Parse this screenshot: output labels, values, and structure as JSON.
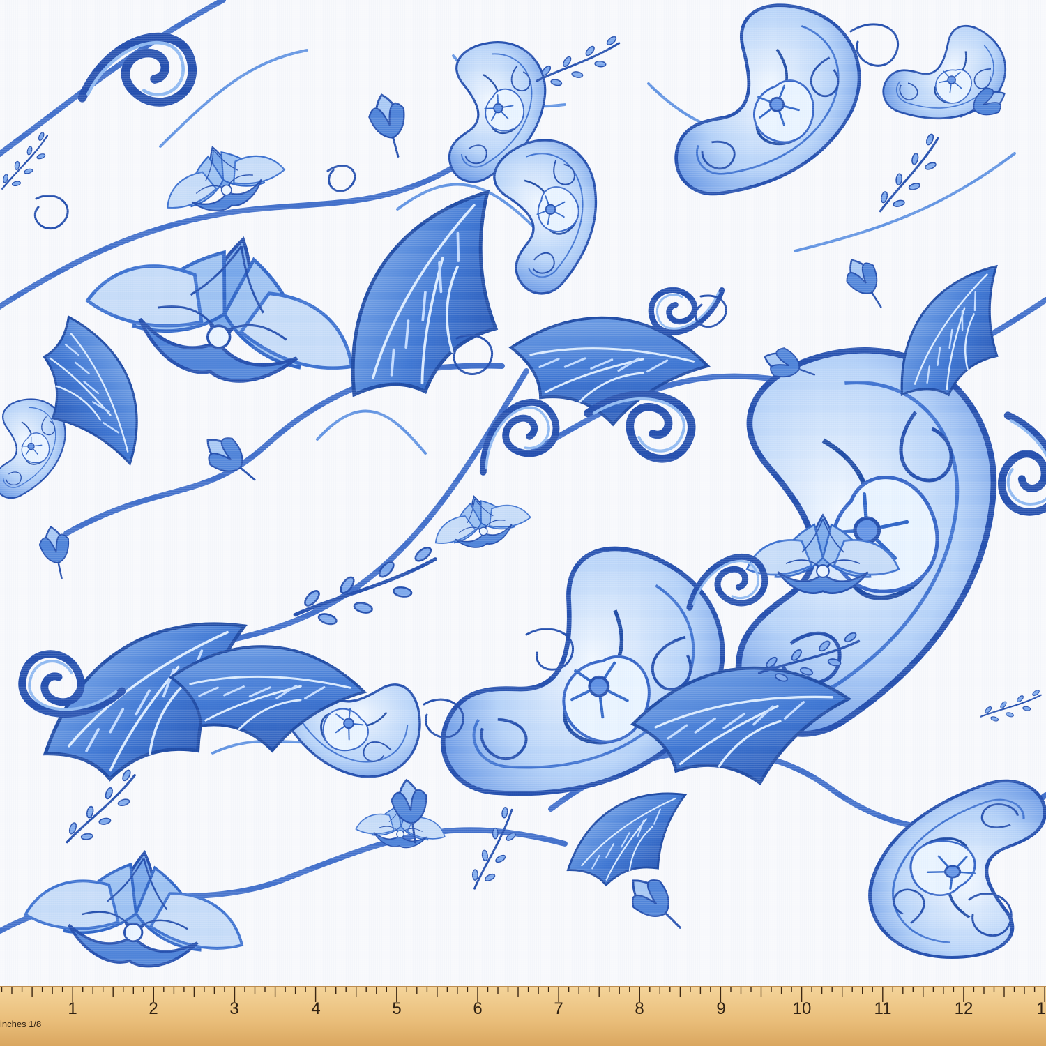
{
  "colors": {
    "background": "#f8f9fc",
    "navy": "#244fae",
    "royal_blue": "#356fd1",
    "mid_blue": "#5e91e2",
    "light_blue": "#9cc2f4",
    "pale_blue": "#d6e8ff",
    "ruler_wood": "#e9bd79",
    "ruler_ink": "#2f2113"
  },
  "ruler": {
    "numbers": [
      "1",
      "2",
      "3",
      "4",
      "5",
      "6",
      "7",
      "8",
      "9",
      "10",
      "11",
      "12",
      "1"
    ],
    "caption": "inches 1/8"
  }
}
